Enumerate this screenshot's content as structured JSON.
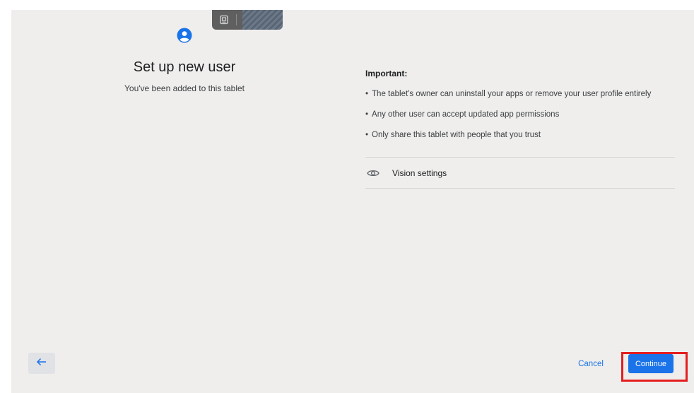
{
  "header": {
    "title": "Set up new user",
    "subtitle": "You've been added to this tablet"
  },
  "important": {
    "heading": "Important:",
    "bullet_char": "•",
    "items": [
      "The tablet's owner can uninstall your apps or remove your user profile entirely",
      "Any other user can accept updated app permissions",
      "Only share this tablet with people that you trust"
    ]
  },
  "vision_settings": {
    "label": "Vision settings",
    "icon": "eye-icon"
  },
  "footer": {
    "back_icon": "arrow-back-icon",
    "cancel_label": "Cancel",
    "continue_label": "Continue"
  },
  "colors": {
    "background": "#efeeec",
    "accent": "#1a73e8",
    "highlight": "#e41e1e",
    "text_primary": "#202124"
  }
}
